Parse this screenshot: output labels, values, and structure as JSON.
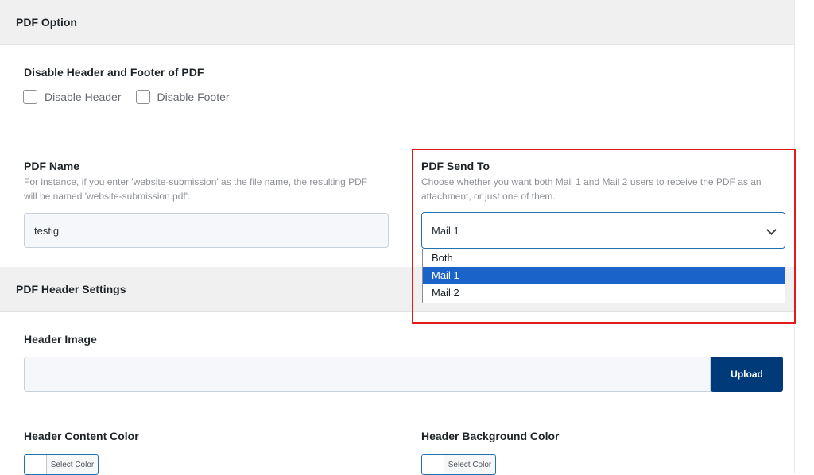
{
  "pdf_option": {
    "title": "PDF Option"
  },
  "disable_section": {
    "label": "Disable Header and Footer of PDF",
    "disable_header_label": "Disable Header",
    "disable_footer_label": "Disable Footer"
  },
  "pdf_name": {
    "label": "PDF Name",
    "description_line1": "For instance, if you enter 'website-submission' as the file name, the resulting PDF",
    "description_line2": "will be named 'website-submission.pdf'.",
    "value": "testig"
  },
  "pdf_send_to": {
    "label": "PDF Send To",
    "description_line1": "Choose whether you want both Mail 1 and Mail 2 users to receive the PDF as an",
    "description_line2": "attachment, or just one of them.",
    "selected": "Mail 1",
    "options": [
      "Both",
      "Mail 1",
      "Mail 2"
    ]
  },
  "pdf_header_settings": {
    "title": "PDF Header Settings"
  },
  "header_image": {
    "label": "Header Image",
    "value": "",
    "upload_label": "Upload"
  },
  "header_content_color": {
    "label": "Header Content Color",
    "button_label": "Select Color"
  },
  "header_background_color": {
    "label": "Header Background Color",
    "button_label": "Select Color"
  },
  "colors": {
    "highlight": "#e21a1a",
    "selected_option": "#1a63c9",
    "upload_button": "#003a78"
  }
}
